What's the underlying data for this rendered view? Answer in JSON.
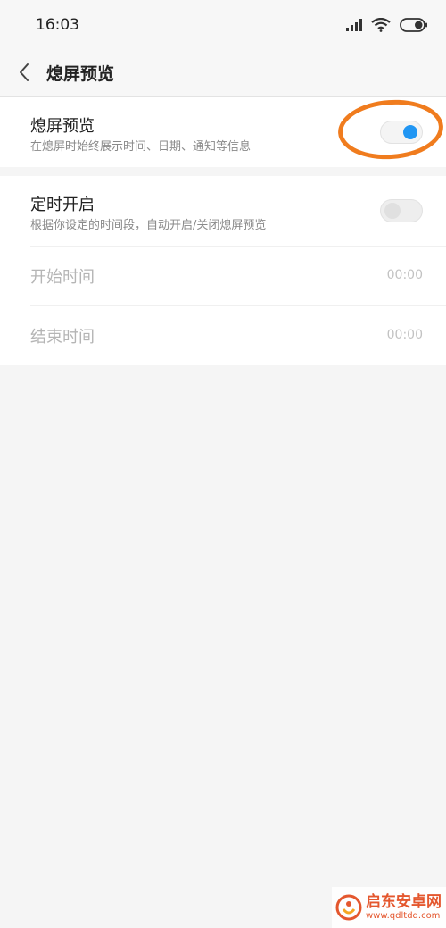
{
  "status_bar": {
    "time": "16:03",
    "icons": [
      "signal-icon",
      "wifi-icon",
      "battery-icon"
    ]
  },
  "header": {
    "title": "熄屏预览",
    "back_icon": "chevron-left-icon"
  },
  "settings": {
    "aod": {
      "title": "熄屏预览",
      "subtitle": "在熄屏时始终展示时间、日期、通知等信息",
      "enabled": true
    },
    "schedule": {
      "title": "定时开启",
      "subtitle": "根据你设定的时间段，自动开启/关闭熄屏预览",
      "enabled": false
    },
    "start_time": {
      "label": "开始时间",
      "value": "00:00"
    },
    "end_time": {
      "label": "结束时间",
      "value": "00:00"
    }
  },
  "watermark": {
    "name": "启东安卓网",
    "url": "www.qdltdq.com"
  },
  "colors": {
    "accent": "#2196f3",
    "highlight": "#f07c1e",
    "background": "#f5f5f5"
  }
}
